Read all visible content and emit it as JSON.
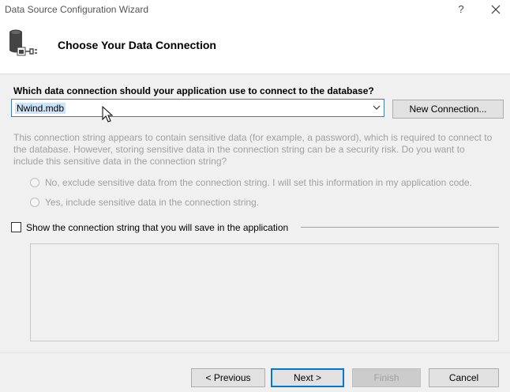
{
  "window": {
    "title": "Data Source Configuration Wizard",
    "help_glyph": "?",
    "close_icon": "close-icon"
  },
  "header": {
    "title": "Choose Your Data Connection",
    "icon": "database-connection-icon"
  },
  "connection": {
    "question": "Which data connection should your application use to connect to the database?",
    "selected": "Nwind.mdb",
    "new_connection_label": "New Connection..."
  },
  "sensitive": {
    "info": "This connection string appears to contain sensitive data (for example, a password), which is required to connect to the database. However, storing sensitive data in the connection string can be a security risk. Do you want to include this sensitive data in the connection string?",
    "option_exclude": "No, exclude sensitive data from the connection string. I will set this information in my application code.",
    "option_include": "Yes, include sensitive data in the connection string."
  },
  "show_string": {
    "label": "Show the connection string that you will save in the application",
    "connection_string": ""
  },
  "footer": {
    "previous_label": "< Previous",
    "next_label": "Next >",
    "finish_label": "Finish",
    "cancel_label": "Cancel"
  }
}
